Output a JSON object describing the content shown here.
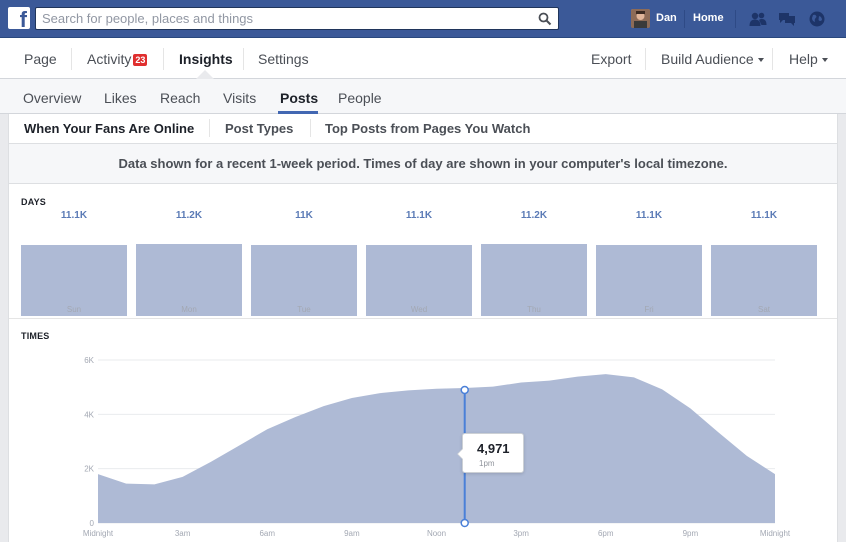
{
  "topbar": {
    "search_placeholder": "Search for people, places and things",
    "user_name": "Dan",
    "home_label": "Home",
    "brand_color": "#3b5998"
  },
  "page_nav": {
    "page": "Page",
    "activity": "Activity",
    "activity_badge": "23",
    "insights": "Insights",
    "settings": "Settings",
    "export": "Export",
    "build_audience": "Build Audience",
    "help": "Help"
  },
  "insights_tabs": {
    "overview": "Overview",
    "likes": "Likes",
    "reach": "Reach",
    "visits": "Visits",
    "posts": "Posts",
    "people": "People",
    "active": "Posts"
  },
  "posts_tabs": {
    "when_online": "When Your Fans Are Online",
    "post_types": "Post Types",
    "top_posts": "Top Posts from Pages You Watch"
  },
  "notice": "Data shown for a recent 1-week period. Times of day are shown in your computer's local timezone.",
  "days_section": {
    "label": "DAYS"
  },
  "times_section": {
    "label": "TIMES"
  },
  "tooltip": {
    "value": "4,971",
    "time": "1pm"
  },
  "chart_data": [
    {
      "type": "bar",
      "categories": [
        "Sun",
        "Mon",
        "Tue",
        "Wed",
        "Thu",
        "Fri",
        "Sat"
      ],
      "value_labels": [
        "11.1K",
        "11.2K",
        "11K",
        "11.1K",
        "11.2K",
        "11.1K",
        "11.1K"
      ],
      "values": [
        11100,
        11200,
        11000,
        11100,
        11200,
        11100,
        11100
      ],
      "color": "#aebad5"
    },
    {
      "type": "area",
      "x": [
        0,
        1,
        2,
        3,
        4,
        5,
        6,
        7,
        8,
        9,
        10,
        11,
        12,
        13,
        14,
        15,
        16,
        17,
        18,
        19,
        20,
        21,
        22,
        23,
        24
      ],
      "values": [
        1800,
        1450,
        1420,
        1700,
        2250,
        2850,
        3450,
        3900,
        4300,
        4600,
        4780,
        4880,
        4940,
        4971,
        5020,
        5170,
        5240,
        5390,
        5480,
        5360,
        4920,
        4220,
        3330,
        2470,
        1800
      ],
      "x_tick_labels": [
        "Midnight",
        "3am",
        "6am",
        "9am",
        "Noon",
        "3pm",
        "6pm",
        "9pm",
        "Midnight"
      ],
      "y_tick_labels": [
        "0",
        "2K",
        "4K",
        "6K"
      ],
      "ylim": [
        0,
        6000
      ],
      "highlight_x": 13,
      "color": "#aebad5",
      "highlight_color": "#4a80d8"
    }
  ]
}
